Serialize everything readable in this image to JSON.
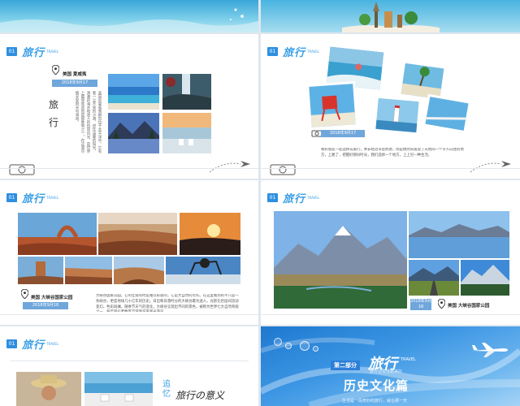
{
  "brand": {
    "logo_text": "旅行",
    "logo_sub": "TRAVEL",
    "accent": "#2e8fe0"
  },
  "slide1": {
    "number": "01",
    "location": "美国 夏威夷",
    "date": "2018年9月17",
    "title": "旅行",
    "body": "美丽的夏威夷群岛位于太平洋中，它有着一尘不染的沙滩，终年温暖的阳光，清澈的海水和迷人的热带风光，是世界上最受欢迎的度假胜地之一。在这里尽情享受阳光与海浪。"
  },
  "slide2": {
    "number": "01",
    "date": "2018年9月17",
    "body": "和好朋友一起选择去旅行，并非经过深思熟虑，而是偶然间发现了天地间一个令人向往的地方，上路了，把握好那份时光，我们选择一个地方，上上另一种生活。"
  },
  "slide3": {
    "number": "01",
    "location": "美国 大峡谷国家公园",
    "date": "2018年9月18",
    "body": "大峡谷国家公园，它的壮观有时是难以形容的，它是大自然的杰作。在这里看到的不只是一条峡谷，更是地球几十亿年的历史。日出和日落时分的大峡谷最为迷人，光影在岩层间流动变幻，色彩斑斓。随季节天气的变化，大峡谷呈现出不同的景色，被称为世界七大自然奇观之一，每年吸引着数百万游客前来观光游览。"
  },
  "slide4": {
    "number": "01",
    "location": "美国 大峡谷国家公园",
    "date": "2018年9月18"
  },
  "slide5": {
    "number": "01",
    "heading": "追忆",
    "script": "旅行の意义"
  },
  "slide6": {
    "part_label": "第二部分",
    "logo_text": "旅行",
    "logo_sub": "TRAVEL",
    "tagline": "旅行让生活更美好",
    "title": "历史文化篇",
    "body": "生活是一段奇妙的旅行，就在那一天"
  }
}
